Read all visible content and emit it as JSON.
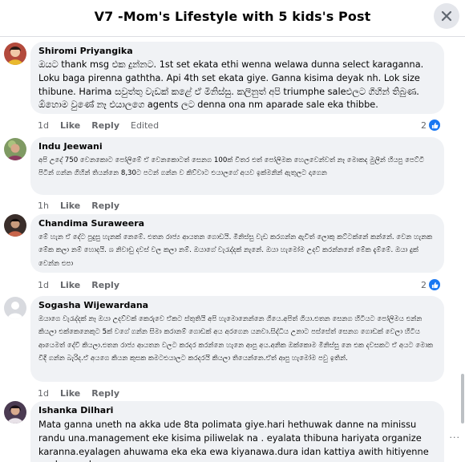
{
  "header": {
    "title": "V7 -Mom's Lifestyle with 5 kids's Post"
  },
  "comments": [
    {
      "author": "Shiromi Priyangika",
      "text": "ඔයට thank msg එක දුන්නට. 1st set ekata ethi wenna welawa dunna select karaganna. Loku baga pirenna gaththa. Api 4th set ekata giye. Ganna kisima deyak nh. Lok size thibune. Harima සවුත්තු වැඩක් කළේ ඒ මිනිස්සු. කලිනුත් අපි triumphe saleඑලට ගිහින් තිබුණ. ඕහොම වුණේ නෑ එයාලගෙ agents ලට denna ona nm aparade sale eka thibbe.",
      "time": "1d",
      "like": "Like",
      "reply": "Reply",
      "edited": "Edited",
      "reaction_count": "2",
      "reaction_icon": "like-icon"
    },
    {
      "author": "Indu Jeewani",
      "text": "අපි උදේ 750 වෙනකොට පෝලිමේ ඒ වෙනකොටත් සෙනග 100ක් විතර එත් පෝලිමක හෙලවෙන්වත් නෑ මොකද මුලින් හියපු පෙට්ටි පිටින් ගන්න ගිහින් තියන්නෙ 8,30ට පටන් ගන්න ව කිව්වාට එයාලගේ අයව ඉක්මනින් ඇතුලට දාගෙන",
      "time": "1h",
      "like": "Like",
      "reply": "Reply"
    },
    {
      "author": "Chandima Suraweera",
      "text": "මේ හැන ඒ දේට පුදුසු හැනක් නෙමේ. එතන රාජ්‍ය ආයතන ගොඩයි. මිනිස්සු වැඩ කරගන්න ඇවිත් ලොකු කට්ටක්නේ කන්නේ. වෙන හැනක මේක කලා නම් හොදයි. ශ නිවාඩු දවස් වල කලා නම්. ඔයාගේ වැරැද්දක් නැනේ. ඔයා හැමෝම උදව් කරන්නනේ මේක දැම්මේ. ඔයා දුක් වෙන්න එපා",
      "time": "1d",
      "like": "Like",
      "reply": "Reply",
      "reaction_count": "2",
      "reaction_icon": "like-icon"
    },
    {
      "author": "Sogasha Wijewardana",
      "text": "ඔයාගෙ වැරැද්දක් නෑ ඔයා උදව්වක් කෙරුවෙ ඒකට ස්තුතියි අපි හැමොනෙන්නෙ ගියෙ.අපිත් ගියා.එතන සෙනග හිටියට පෝලිමය එන්න කියලා එක්කෙනෙකුට 5ක් වගේ ගන්න සිමා කරානම් ගොඩක් අය අරගෙන යනවා.සිද්ධිය උනාට පස්සේත් සෙනග ගොඩක් වෙලා හිටිය ආයෙමත් දේවී කියලා.එතන රාජ්‍ය ආයතන වලට කරදර කරන්නෙ හැනෙ ආපු අය.අනික ඔක්කොම මිනිස්සු නෙ එක දවසකට ඒ අයට මොක විදි ගන්න බැරිද.ඒ අයගෙ කියන කුසක කමටඑයාලට කරදරයි කියලා තියෙන්නෙ.ඒත් ආපු හැමෝම පවු ඉතින්.",
      "time": "1d",
      "like": "Like",
      "reply": "Reply"
    },
    {
      "author": "Ishanka Dilhari",
      "text": "Mata ganna uneth na akka ude 8ta polimata giye.hari hethuwak danne na minissu randu una.management eke kisima piliwelak na . eyalata thibuna hariyata organize karanna.eyalagen ahuwama eka eka ewa kiyanawa.dura idan kattiya awith hitiyenne eyalagen ahuwa"
    }
  ],
  "more_options": "···",
  "colors": {
    "bubble_bg": "#f0f2f5",
    "like_blue": "#1877f2",
    "meta_gray": "#65676b"
  }
}
